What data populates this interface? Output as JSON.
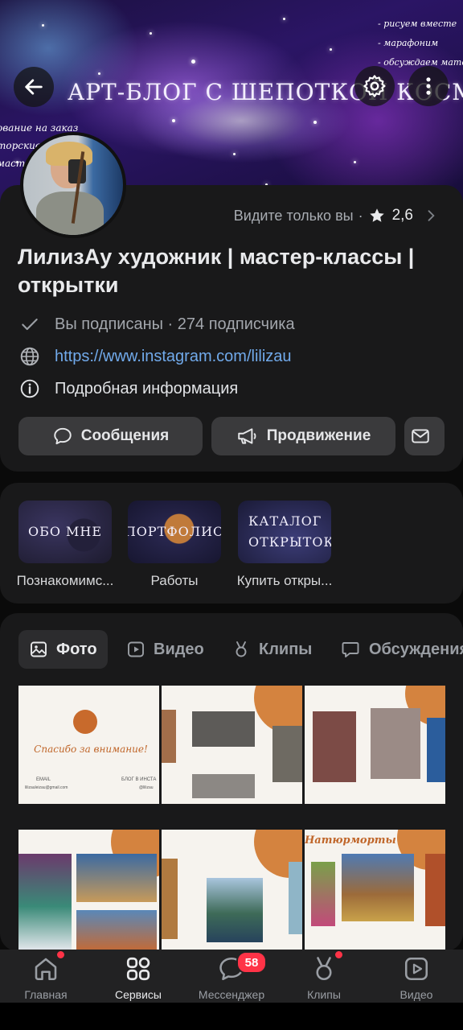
{
  "cover": {
    "title": "АРТ-БЛОГ С ШЕПОТКОЙ КОСМОСА",
    "left_lines": [
      "ование на заказ",
      "торские о",
      "мастер-"
    ],
    "right_lines": [
      "- рисуем вместе",
      "- марафоним",
      "- обсуждаем матер"
    ]
  },
  "profile": {
    "visibility_note": "Видите только вы",
    "rating": "2,6",
    "name": "ЛилизАу художник | мастер-классы | открытки",
    "subscribed": "Вы подписаны",
    "separator": " · ",
    "subscribers": "274 подписчика",
    "link": "https://www.instagram.com/lilizau",
    "details": "Подробная информация"
  },
  "actions": {
    "messages": "Сообщения",
    "promotion": "Продвижение"
  },
  "shelf": [
    {
      "cover_text": "ОБО МНЕ",
      "label": "Познакомимс..."
    },
    {
      "cover_text": "ПОРТФОЛИО",
      "label": "Работы"
    },
    {
      "cover_text": "КАТАЛОГ ОТКРЫТОК",
      "label": "Купить откры..."
    }
  ],
  "tabs": {
    "photo": "Фото",
    "video": "Видео",
    "clips": "Клипы",
    "discussions": "Обсуждения"
  },
  "photos": {
    "p1_title": "Спасибо за внимание!",
    "p1_email_label": "EMAIL",
    "p1_email": "lilizauleizau@gmail.com",
    "p1_blog_label": "БЛОГ В ИНСТА",
    "p1_blog": "@lilizau",
    "p6_title": "Натюрморты"
  },
  "nav": {
    "home": "Главная",
    "services": "Сервисы",
    "messenger": "Мессенджер",
    "messenger_badge": "58",
    "clips": "Клипы",
    "video": "Видео"
  },
  "colors": {
    "accent_link": "#71aaeb",
    "badge": "#ff3347",
    "card_bg": "#19191a"
  }
}
